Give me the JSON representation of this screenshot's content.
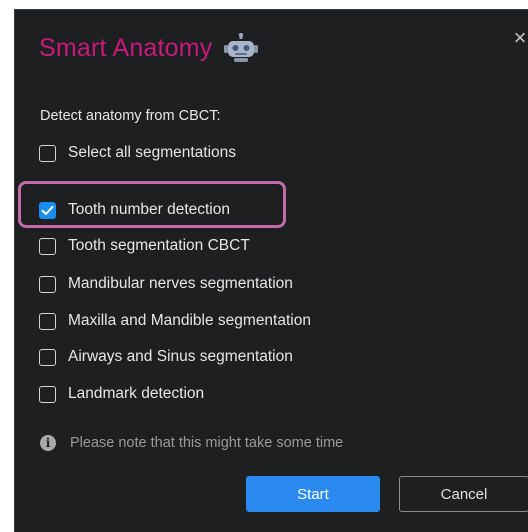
{
  "dialog": {
    "title": "Smart Anatomy",
    "close_glyph": "×",
    "section_label": "Detect anatomy from CBCT:",
    "select_all": {
      "label": "Select all segmentations",
      "checked": false
    },
    "options": [
      {
        "label": "Tooth number detection",
        "checked": true,
        "highlighted": true
      },
      {
        "label": "Tooth segmentation CBCT",
        "checked": false
      },
      {
        "label": "Mandibular nerves segmentation",
        "checked": false
      },
      {
        "label": "Maxilla and Mandible segmentation",
        "checked": false
      },
      {
        "label": "Airways and Sinus segmentation",
        "checked": false
      },
      {
        "label": "Landmark detection",
        "checked": false
      }
    ],
    "note": {
      "icon": "info-icon",
      "glyph": "i",
      "text": "Please note that this might take some time"
    },
    "buttons": {
      "start": "Start",
      "cancel": "Cancel"
    }
  },
  "colors": {
    "background": "#1e1f20",
    "title": "#c8197d",
    "accent": "#2a8af0",
    "highlight": "#c36aa8"
  }
}
